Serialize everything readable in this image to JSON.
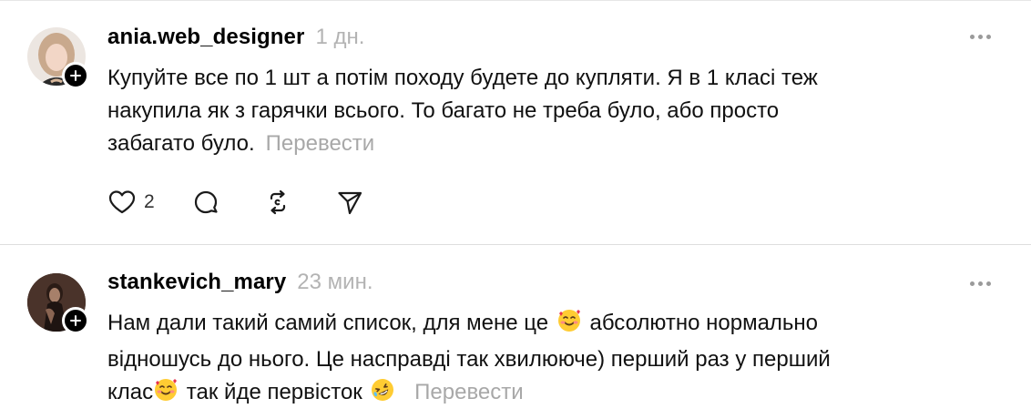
{
  "posts": [
    {
      "username": "ania.web_designer",
      "timestamp": "1 дн.",
      "text_lines": [
        "Купуйте все по 1 шт а потім походу будете до купляти. Я в 1 класі теж",
        "накупила як з гарячки всього. То багато не треба було, або просто",
        "забагато було."
      ],
      "translate_label": "Перевести",
      "likes": "2"
    },
    {
      "username": "stankevich_mary",
      "timestamp": "23 мин.",
      "line1_a": "Нам дали такий самий список, для мене це",
      "line1_b": "абсолютно нормально",
      "line2": "відношусь до нього. Це насправді так хвилююче) перший раз у перший",
      "line3_a": "клас",
      "line3_b": "так йде первісток",
      "translate_label": "Перевести"
    }
  ],
  "icons": {
    "follow": "plus-icon",
    "more": "more-dots-icon",
    "like": "heart-icon",
    "comment": "comment-bubble-icon",
    "repost": "repost-icon",
    "share": "send-icon",
    "emoji_love": "smiling-face-with-hearts-emoji",
    "emoji_laugh": "rolling-on-floor-laughing-emoji"
  }
}
